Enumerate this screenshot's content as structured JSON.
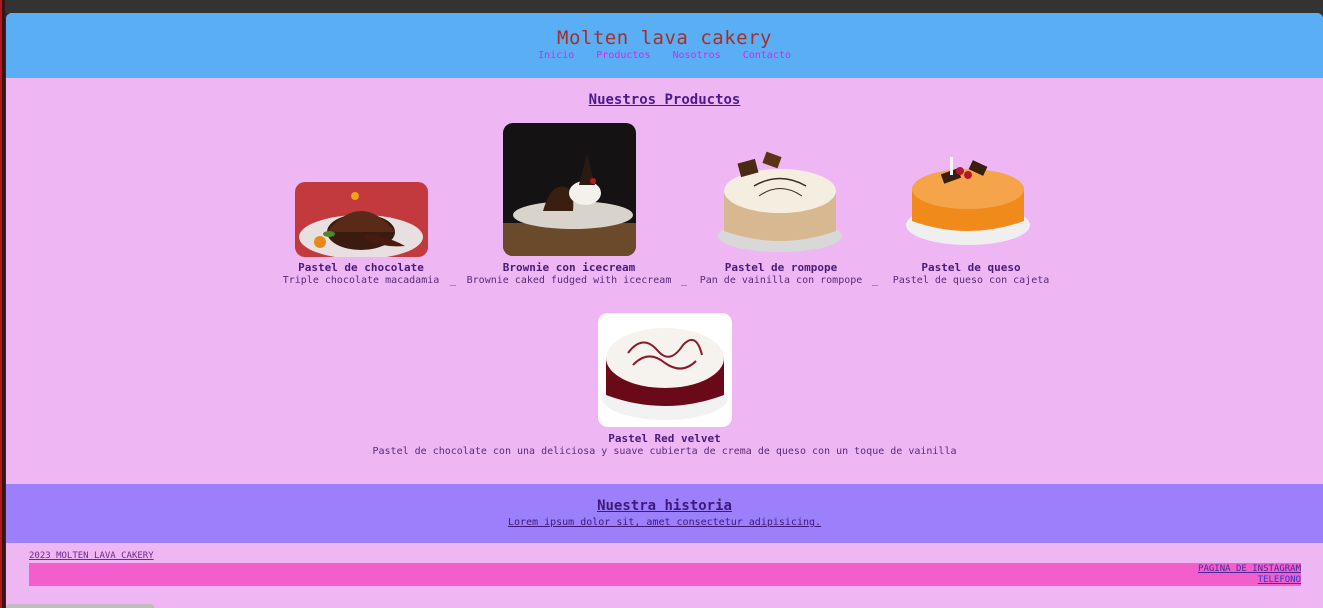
{
  "header": {
    "title": "Molten lava cakery",
    "nav": [
      "Inicio",
      "Productos",
      "Nosotros",
      "Contacto"
    ]
  },
  "products": {
    "title": "Nuestros Productos",
    "separator": "_",
    "items": [
      {
        "name": "Pastel de chocolate",
        "desc": "Triple chocolate macadamia"
      },
      {
        "name": "Brownie con icecream",
        "desc": "Brownie caked fudged with icecream"
      },
      {
        "name": "Pastel de rompope",
        "desc": "Pan de vainilla con rompope"
      },
      {
        "name": "Pastel de queso",
        "desc": "Pastel de queso con cajeta"
      },
      {
        "name": "Pastel Red velvet",
        "desc": "Pastel de chocolate con una deliciosa y suave cubierta de crema de queso con un toque de vainilla"
      }
    ]
  },
  "history": {
    "title": "Nuestra historia",
    "text": "Lorem ipsum dolor sit, amet consectetur adipisicing."
  },
  "footer": {
    "copyright": "2023 MOLTEN LAVA CAKERY",
    "instagram": "PAGINA DE INSTAGRAM",
    "phone": "TELEFONO"
  },
  "colors": {
    "header_bg": "#5aaef4",
    "page_bg": "#eeb7f4",
    "history_bg": "#9c80fb",
    "footer_bar": "#f25fcc",
    "title": "#a3302d",
    "nav_link": "#e21ff0"
  }
}
